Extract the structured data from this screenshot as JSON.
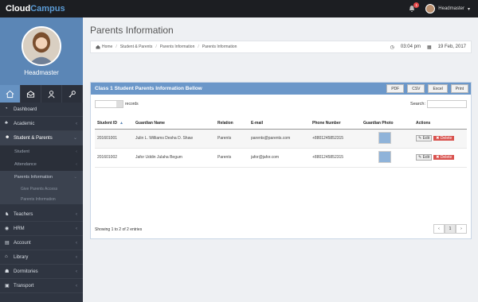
{
  "app": {
    "brand_part1": "Cloud",
    "brand_part2": "Campus",
    "notifications": "1",
    "user_name": "Headmaster"
  },
  "sidebar": {
    "role": "Headmaster",
    "items": [
      {
        "label": "Dashboard"
      },
      {
        "label": "Academic"
      },
      {
        "label": "Student & Parents"
      },
      {
        "label": "Teachers"
      },
      {
        "label": "HRM"
      },
      {
        "label": "Account"
      },
      {
        "label": "Library"
      },
      {
        "label": "Dormitories"
      },
      {
        "label": "Transport"
      }
    ],
    "sub_items": [
      {
        "label": "Student"
      },
      {
        "label": "Attendance"
      },
      {
        "label": "Parents Information"
      }
    ],
    "sub_sub_items": [
      {
        "label": "Give Parents Access"
      },
      {
        "label": "Parents Information"
      }
    ]
  },
  "page": {
    "title": "Parents Information",
    "breadcrumb": [
      "Home",
      "Student & Parents",
      "Parents Information",
      "Parents Information"
    ],
    "time": "03:04 pm",
    "date": "19 Feb, 2017"
  },
  "panel": {
    "title": "Class 1 Student Parents Information Bellow",
    "export_buttons": [
      "PDF",
      "CSV",
      "Excel",
      "Print"
    ],
    "length_suffix": "records",
    "search_label": "Search:",
    "columns": [
      "Student ID",
      "Guardian Name",
      "Relation",
      "E-mail",
      "Phone Number",
      "Guardian Photo",
      "Actions"
    ],
    "rows": [
      [
        "201601001",
        "Julin L. Williams Desha D. Shaw",
        "Parents",
        "parents@parents.com",
        "+8801245852315"
      ],
      [
        "201601002",
        "Jafor Uddin Julaha Begum",
        "Parents",
        "jafor@jafor.com",
        "+8801245852315"
      ]
    ],
    "edit_label": "Edit",
    "delete_label": "Delete",
    "info": "Showing 1 to 2 of 2 entries",
    "page_current": "1"
  },
  "colors": {
    "sidebar": "#2f3541",
    "profile": "#5b86b6",
    "panel_header": "#6b97c9",
    "delete": "#d9534f"
  }
}
